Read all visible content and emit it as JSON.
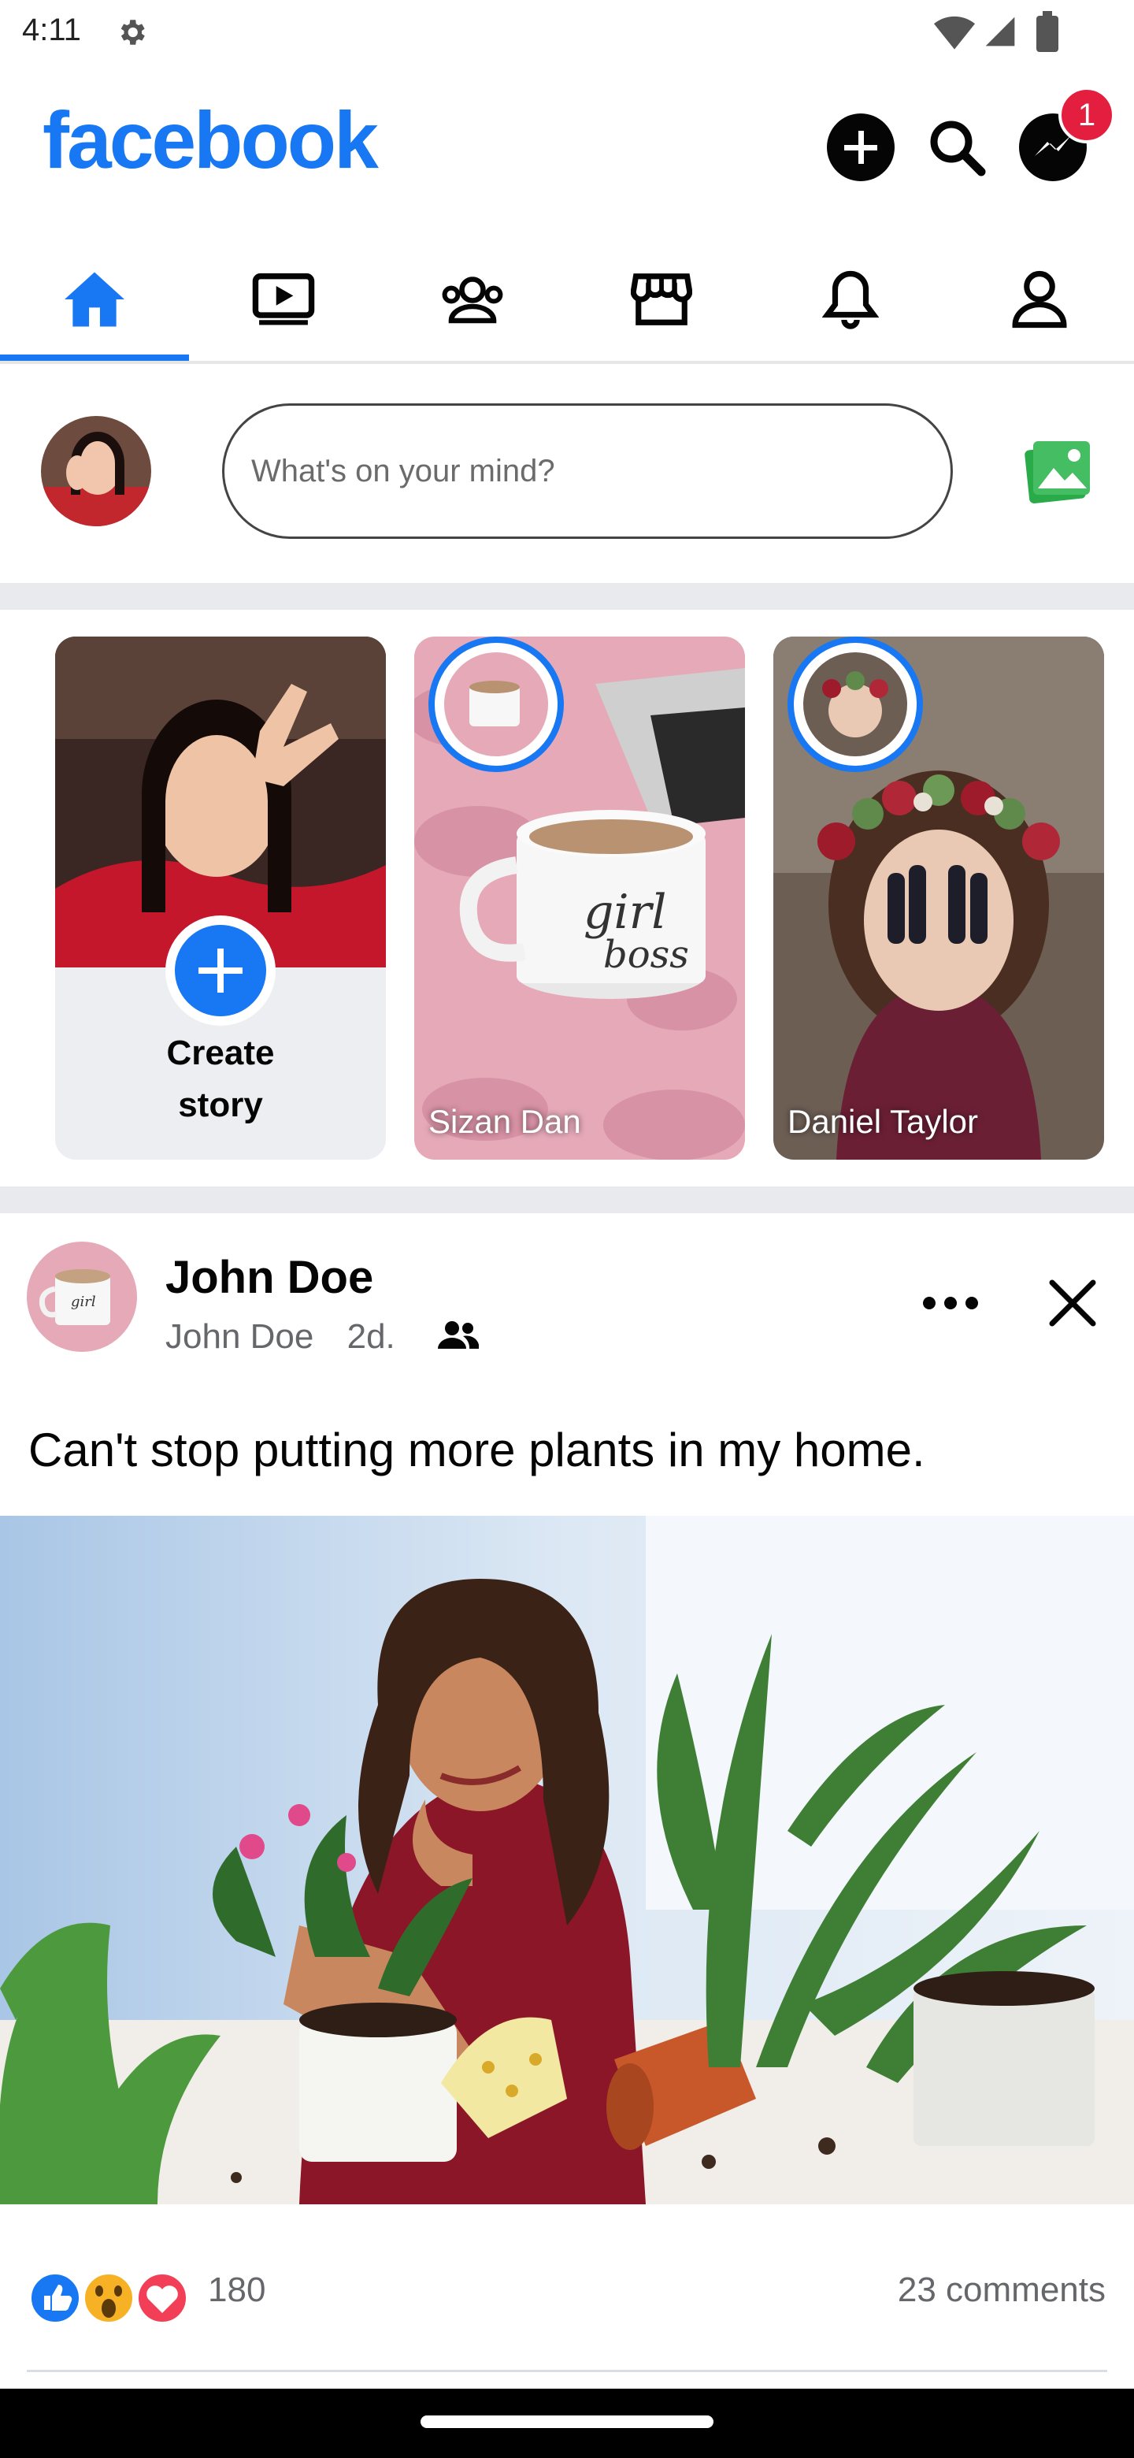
{
  "status_bar": {
    "time": "4:11"
  },
  "header": {
    "logo": "facebook",
    "messenger_badge": "1"
  },
  "tabs": [
    {
      "name": "home",
      "icon": "home-icon",
      "active": true
    },
    {
      "name": "watch",
      "icon": "video-icon"
    },
    {
      "name": "groups",
      "icon": "groups-icon"
    },
    {
      "name": "marketplace",
      "icon": "store-icon"
    },
    {
      "name": "notifications",
      "icon": "bell-icon"
    },
    {
      "name": "profile",
      "icon": "person-icon"
    }
  ],
  "composer": {
    "placeholder": "What's on your mind?"
  },
  "stories": {
    "create_label_line1": "Create",
    "create_label_line2": "story",
    "items": [
      {
        "name": "Sizan Dan"
      },
      {
        "name": "Daniel Taylor"
      }
    ]
  },
  "post": {
    "author": "John Doe",
    "meta_author": "John Doe",
    "age": "2d.",
    "text": "Can't stop putting more plants in my home.",
    "reactions_count": "180",
    "comments_label": "23 comments"
  },
  "colors": {
    "accent": "#1877F2",
    "badge": "#E41E3F"
  }
}
